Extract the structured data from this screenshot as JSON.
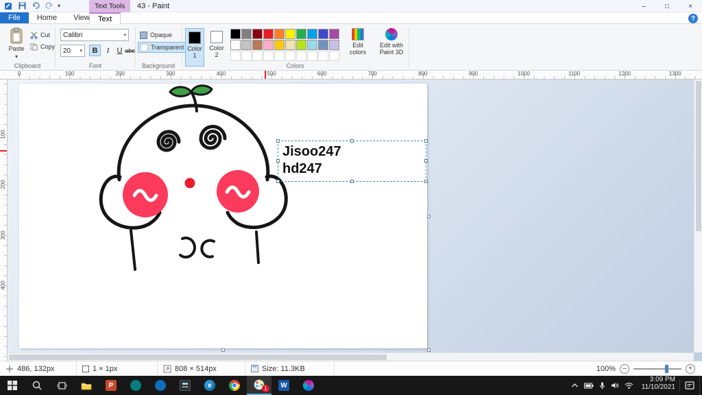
{
  "theme": {
    "accent": "#0078d7",
    "file_blue": "#2173cd",
    "context_purple": "#dcb9e4",
    "selection_blue": "#cce4f7",
    "ink": "#161616",
    "cheek": "#fb3a5c",
    "nose": "#e81c2e",
    "leaf": "#3fa047",
    "taskbar_bg": "#171717",
    "badge_red": "#e81224"
  },
  "titlebar": {
    "context_label": "Text Tools",
    "title": "43 - Paint",
    "minimize": "–",
    "maximize": "□",
    "close": "×"
  },
  "tabs": {
    "file": "File",
    "home": "Home",
    "view": "View",
    "text": "Text",
    "help": "?"
  },
  "ribbon": {
    "clipboard": {
      "label": "Clipboard",
      "paste": "Paste",
      "cut": "Cut",
      "copy": "Copy"
    },
    "font": {
      "label": "Font",
      "family": "Calibri",
      "size": "20",
      "bold": "B",
      "italic": "I",
      "underline": "U",
      "strikethrough": "abc"
    },
    "background": {
      "label": "Background",
      "opaque": "Opaque",
      "transparent": "Transparent"
    },
    "colors": {
      "label": "Colors",
      "color1_label": "Color 1",
      "color2_label": "Color 2",
      "color1_value": "#000000",
      "color2_value": "#ffffff",
      "edit_colors": "Edit colors",
      "edit_3d": "Edit with Paint 3D",
      "palette_row1": [
        "#000000",
        "#7f7f7f",
        "#880015",
        "#ed1c24",
        "#ff7f27",
        "#fff200",
        "#22b14c",
        "#00a2e8",
        "#3f48cc",
        "#a349a4"
      ],
      "palette_row2": [
        "#ffffff",
        "#c3c3c3",
        "#b97a57",
        "#ffaec9",
        "#ffc90e",
        "#efe4b0",
        "#b5e61d",
        "#99d9ea",
        "#7092be",
        "#c8bfe7"
      ],
      "palette_row3": [
        "",
        "",
        "",
        "",
        "",
        "",
        "",
        "",
        "",
        ""
      ]
    }
  },
  "ruler": {
    "h_marks": [
      "0",
      "100",
      "200",
      "300",
      "400",
      "500",
      "600",
      "700",
      "800",
      "900",
      "1000",
      "1100",
      "1200",
      "1300"
    ],
    "v_marks": [
      "100",
      "200",
      "300",
      "400"
    ]
  },
  "canvas": {
    "text_line1": "Jisoo247",
    "text_line2": "hd247"
  },
  "statusbar": {
    "cursor_pos": "486, 132px",
    "selection_size": "1 × 1px",
    "canvas_size": "808 × 514px",
    "file_size": "Size: 11.3KB",
    "zoom": "100%",
    "zoom_out": "–",
    "zoom_in": "+"
  },
  "taskbar": {
    "time": "3:09 PM",
    "date": "11/10/2021",
    "badge": "1",
    "apps": {
      "powerpoint": "P",
      "word": "W",
      "edge": "e"
    }
  }
}
